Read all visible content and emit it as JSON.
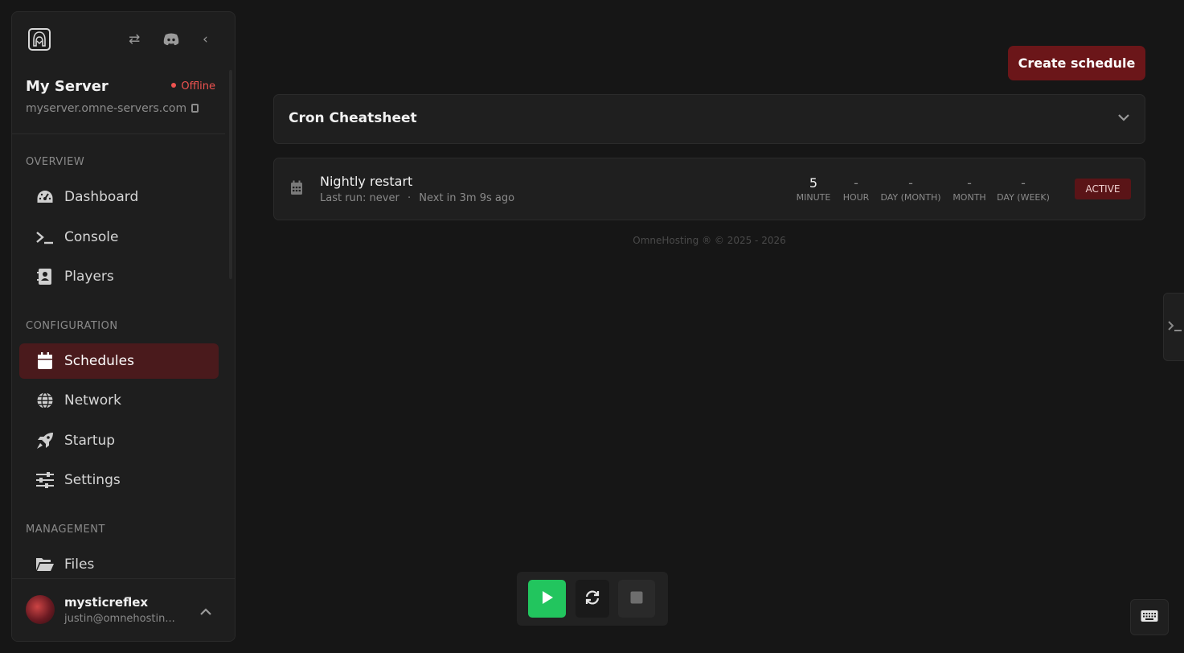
{
  "sidebar": {
    "server_name": "My Server",
    "status": "Offline",
    "hostname": "myserver.omne-servers.com",
    "sections": {
      "overview": "OVERVIEW",
      "configuration": "CONFIGURATION",
      "management": "MANAGEMENT"
    },
    "items": {
      "dashboard": "Dashboard",
      "console": "Console",
      "players": "Players",
      "schedules": "Schedules",
      "network": "Network",
      "startup": "Startup",
      "settings": "Settings",
      "files": "Files"
    },
    "active_item": "Schedules",
    "user": {
      "name": "mysticreflex",
      "email": "justin@omnehostin..."
    }
  },
  "main": {
    "create_button": "Create schedule",
    "cheatsheet_title": "Cron Cheatsheet",
    "schedule": {
      "name": "Nightly restart",
      "last_run": "Last run: never",
      "separator": "·",
      "next_run": "Next in 3m 9s ago",
      "cron": [
        {
          "value": "5",
          "label": "MINUTE"
        },
        {
          "value": "-",
          "label": "HOUR"
        },
        {
          "value": "-",
          "label": "DAY (MONTH)"
        },
        {
          "value": "-",
          "label": "MONTH"
        },
        {
          "value": "-",
          "label": "DAY (WEEK)"
        }
      ],
      "status_badge": "ACTIVE"
    },
    "footer": "OmneHosting ® © 2025 - 2026"
  },
  "colors": {
    "accent": "#6b1619",
    "active_nav": "#4a1a1c",
    "offline": "#ef5350",
    "start": "#22c55e"
  },
  "icons": {
    "logo": "hooded-figure-logo",
    "swap": "swap-icon",
    "discord": "discord-icon",
    "collapse": "chevron-left-icon",
    "copy": "copy-icon",
    "dashboard": "gauge-icon",
    "console": "terminal-icon",
    "players": "contact-book-icon",
    "schedules": "calendar-icon",
    "network": "globe-icon",
    "startup": "rocket-icon",
    "settings": "sliders-icon",
    "files": "folder-open-icon",
    "start": "play-icon",
    "restart": "refresh-icon",
    "stop": "stop-icon",
    "keyboard": "keyboard-icon"
  }
}
